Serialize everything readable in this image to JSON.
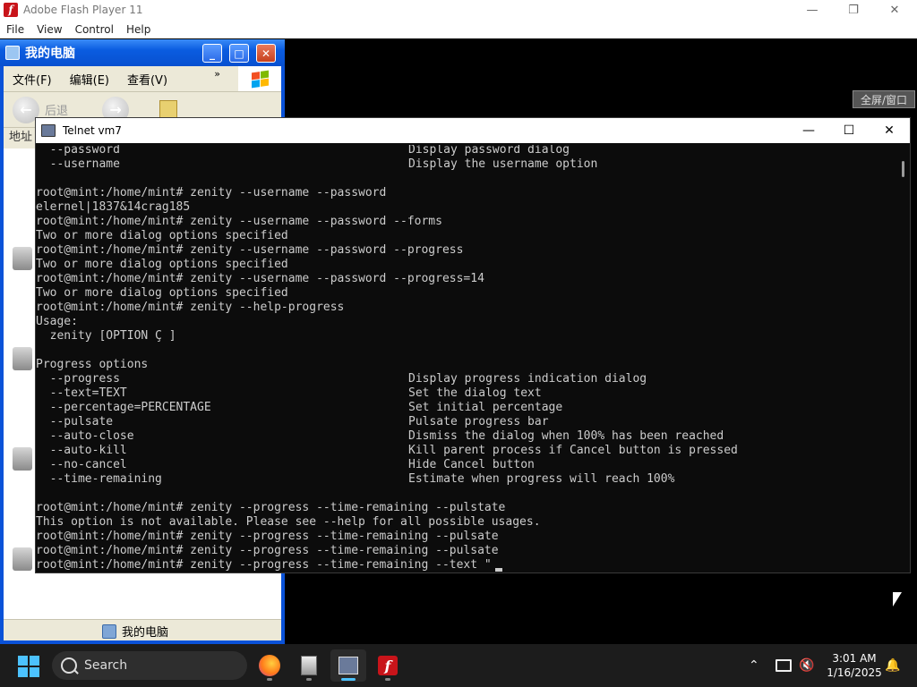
{
  "flash": {
    "title": "Adobe Flash Player 11",
    "menu": [
      "File",
      "View",
      "Control",
      "Help"
    ]
  },
  "xp_window": {
    "title": "我的电脑",
    "menu": [
      "文件(F)",
      "编辑(E)",
      "查看(V)"
    ],
    "more": "»",
    "back_label": "后退",
    "address_label": "地址",
    "status_label": "我的电脑",
    "fullscreen_label": "全屏/窗口"
  },
  "telnet": {
    "title": "Telnet vm7",
    "lines": [
      {
        "cmd": "  --password",
        "desc": "Display password dialog"
      },
      {
        "cmd": "  --username",
        "desc": "Display the username option"
      },
      {
        "cmd": "",
        "desc": ""
      },
      {
        "cmd": "root@mint:/home/mint# zenity --username --password",
        "desc": ""
      },
      {
        "cmd": "elernel|1837&14crag185",
        "desc": ""
      },
      {
        "cmd": "root@mint:/home/mint# zenity --username --password --forms",
        "desc": ""
      },
      {
        "cmd": "Two or more dialog options specified",
        "desc": ""
      },
      {
        "cmd": "root@mint:/home/mint# zenity --username --password --progress",
        "desc": ""
      },
      {
        "cmd": "Two or more dialog options specified",
        "desc": ""
      },
      {
        "cmd": "root@mint:/home/mint# zenity --username --password --progress=14",
        "desc": ""
      },
      {
        "cmd": "Two or more dialog options specified",
        "desc": ""
      },
      {
        "cmd": "root@mint:/home/mint# zenity --help-progress",
        "desc": ""
      },
      {
        "cmd": "Usage:",
        "desc": ""
      },
      {
        "cmd": "  zenity [OPTION Ç ]",
        "desc": ""
      },
      {
        "cmd": "",
        "desc": ""
      },
      {
        "cmd": "Progress options",
        "desc": ""
      },
      {
        "cmd": "  --progress",
        "desc": "Display progress indication dialog"
      },
      {
        "cmd": "  --text=TEXT",
        "desc": "Set the dialog text"
      },
      {
        "cmd": "  --percentage=PERCENTAGE",
        "desc": "Set initial percentage"
      },
      {
        "cmd": "  --pulsate",
        "desc": "Pulsate progress bar"
      },
      {
        "cmd": "  --auto-close",
        "desc": "Dismiss the dialog when 100% has been reached"
      },
      {
        "cmd": "  --auto-kill",
        "desc": "Kill parent process if Cancel button is pressed"
      },
      {
        "cmd": "  --no-cancel",
        "desc": "Hide Cancel button"
      },
      {
        "cmd": "  --time-remaining",
        "desc": "Estimate when progress will reach 100%"
      },
      {
        "cmd": "",
        "desc": ""
      },
      {
        "cmd": "root@mint:/home/mint# zenity --progress --time-remaining --pulstate",
        "desc": ""
      },
      {
        "cmd": "This option is not available. Please see --help for all possible usages.",
        "desc": ""
      },
      {
        "cmd": "root@mint:/home/mint# zenity --progress --time-remaining --pulsate",
        "desc": ""
      },
      {
        "cmd": "root@mint:/home/mint# zenity --progress --time-remaining --pulsate",
        "desc": ""
      },
      {
        "cmd": "root@mint:/home/mint# zenity --progress --time-remaining --text \"",
        "desc": ""
      }
    ]
  },
  "taskbar": {
    "search_label": "Search",
    "time": "3:01 AM",
    "date": "1/16/2025"
  },
  "colors": {
    "terminal_bg": "#0c0c0c",
    "terminal_fg": "#cccccc",
    "xp_blue": "#0a52d8",
    "accent": "#4cc2ff"
  }
}
